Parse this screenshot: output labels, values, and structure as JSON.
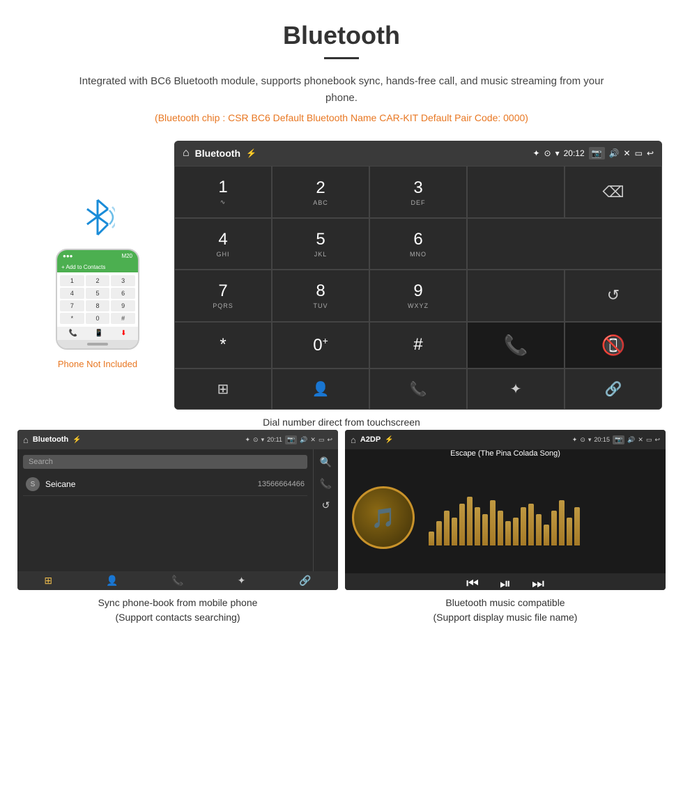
{
  "page": {
    "title": "Bluetooth",
    "description": "Integrated with BC6 Bluetooth module, supports phonebook sync, hands-free call, and music streaming from your phone.",
    "specs": "(Bluetooth chip : CSR BC6    Default Bluetooth Name CAR-KIT    Default Pair Code: 0000)",
    "dial_caption": "Dial number direct from touchscreen",
    "phonebook_caption_line1": "Sync phone-book from mobile phone",
    "phonebook_caption_line2": "(Support contacts searching)",
    "music_caption_line1": "Bluetooth music compatible",
    "music_caption_line2": "(Support display music file name)",
    "phone_not_included": "Phone Not Included"
  },
  "dial_screen": {
    "title": "Bluetooth",
    "time": "20:12",
    "keys": [
      {
        "num": "1",
        "sub": ""
      },
      {
        "num": "2",
        "sub": "ABC"
      },
      {
        "num": "3",
        "sub": "DEF"
      },
      {
        "num": "4",
        "sub": "GHI"
      },
      {
        "num": "5",
        "sub": "JKL"
      },
      {
        "num": "6",
        "sub": "MNO"
      },
      {
        "num": "7",
        "sub": "PQRS"
      },
      {
        "num": "8",
        "sub": "TUV"
      },
      {
        "num": "9",
        "sub": "WXYZ"
      },
      {
        "num": "*",
        "sub": ""
      },
      {
        "num": "0",
        "sub": "+"
      },
      {
        "num": "#",
        "sub": ""
      }
    ]
  },
  "phonebook_screen": {
    "title": "Bluetooth",
    "time": "20:11",
    "search_placeholder": "Search",
    "contact_name": "Seicane",
    "contact_initial": "S",
    "contact_number": "13566664466"
  },
  "music_screen": {
    "title": "A2DP",
    "time": "20:15",
    "song_title": "Escape (The Pina Colada Song)",
    "eq_bars": [
      20,
      35,
      50,
      40,
      60,
      70,
      55,
      45,
      65,
      50,
      35,
      40,
      55,
      60,
      45,
      30,
      50,
      65,
      40,
      55
    ]
  }
}
